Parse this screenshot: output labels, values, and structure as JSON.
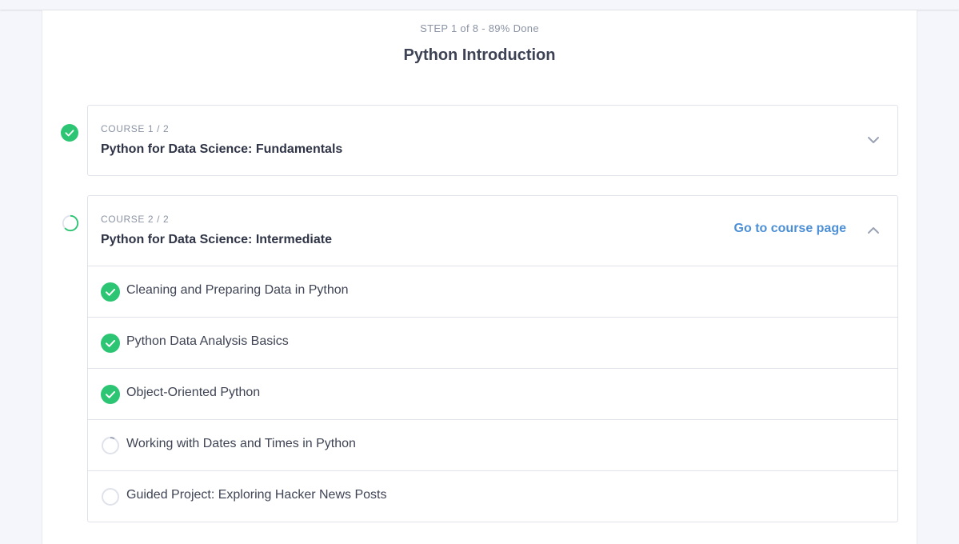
{
  "header": {
    "step_text": "STEP 1 of 8 - 89% Done",
    "title": "Python Introduction"
  },
  "courses": [
    {
      "eyebrow": "COURSE 1 / 2",
      "title": "Python for Data Science: Fundamentals",
      "status": "complete",
      "expanded": false
    },
    {
      "eyebrow": "COURSE 2 / 2",
      "title": "Python for Data Science: Intermediate",
      "status": "in-progress",
      "expanded": true,
      "go_link": "Go to course page",
      "lessons": [
        {
          "title": "Cleaning and Preparing Data in Python",
          "status": "complete"
        },
        {
          "title": "Python Data Analysis Basics",
          "status": "complete"
        },
        {
          "title": "Object-Oriented Python",
          "status": "complete"
        },
        {
          "title": "Working with Dates and Times in Python",
          "status": "in-progress"
        },
        {
          "title": "Guided Project: Exploring Hacker News Posts",
          "status": "not-started"
        }
      ]
    }
  ],
  "colors": {
    "accent_green": "#2cc573",
    "link_blue": "#4c8fd6",
    "icons": [
      "check-circle-icon",
      "progress-ring-icon",
      "empty-circle-icon",
      "chevron-down-icon",
      "chevron-up-icon"
    ]
  }
}
